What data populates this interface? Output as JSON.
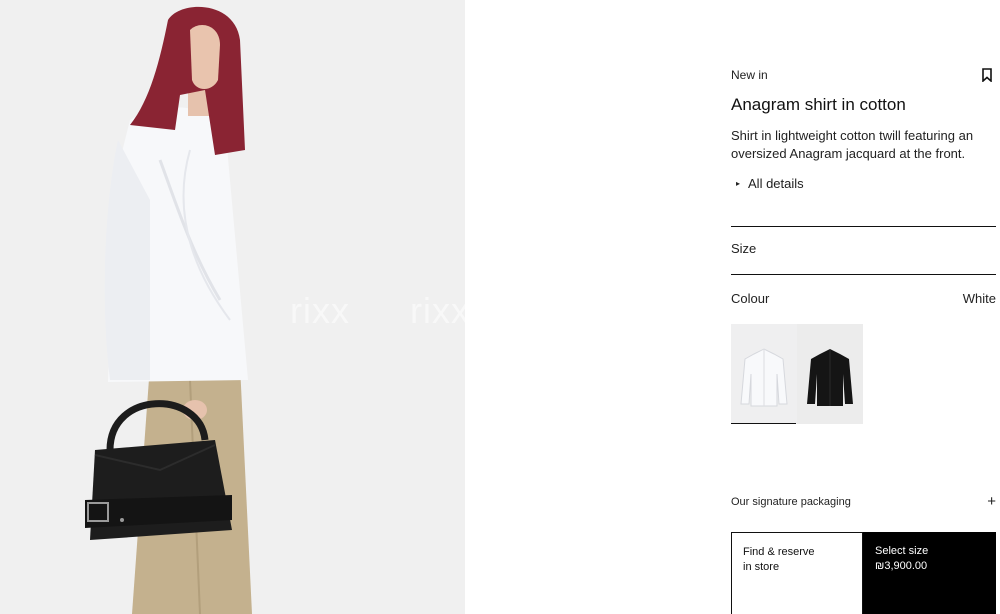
{
  "hero": {
    "watermark_1": "rixx",
    "watermark_2": "rixx"
  },
  "product": {
    "badge": "New in",
    "title": "Anagram shirt in cotton",
    "description": "Shirt in lightweight cotton twill featuring an oversized Anagram jacquard at the front.",
    "details_label": "All details",
    "size_label": "Size",
    "colour_label": "Colour",
    "colour_value": "White",
    "swatches": [
      {
        "name": "White",
        "selected": true
      },
      {
        "name": "Black",
        "selected": false
      }
    ],
    "packaging_label": "Our signature packaging",
    "packaging_icon": "+",
    "details_icon": "▸"
  },
  "actions": {
    "find_line1": "Find & reserve",
    "find_line2": "in store",
    "select_label": "Select size",
    "price": "₪3,900.00"
  },
  "colors": {
    "background": "#ffffff",
    "hero_background": "#f0f0f0",
    "primary_button": "#000000"
  }
}
